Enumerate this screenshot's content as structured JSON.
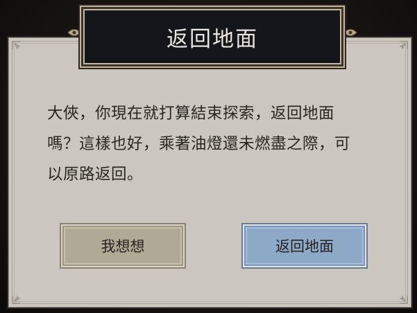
{
  "dialog": {
    "title": "返回地面",
    "message_lines": [
      "大俠，你現在就打算結束探索，返回地面",
      "嗎？這樣也好，乘著油燈還未燃盡之際，可",
      "以原路返回。"
    ],
    "buttons": {
      "cancel_label": "我想想",
      "confirm_label": "返回地面"
    }
  },
  "colors": {
    "panel_bg": "#cbc6c0",
    "title_bg": "#15161c",
    "cancel_button": "#b0a996",
    "confirm_button": "#8ea8c7"
  },
  "icons": [
    "corner-ornament-icon",
    "title-ornament-icon"
  ]
}
